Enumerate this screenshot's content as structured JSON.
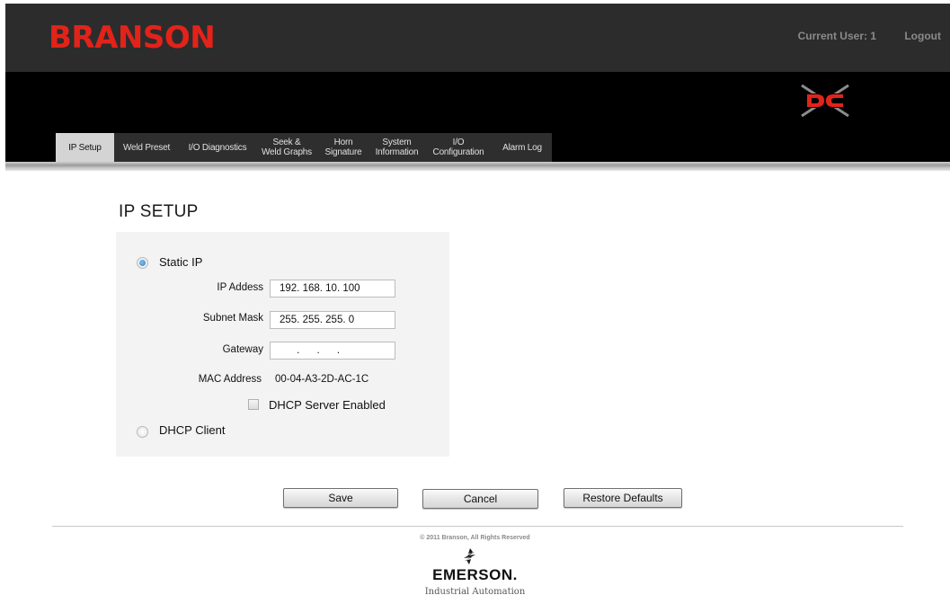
{
  "header": {
    "brand": "BRANSON",
    "current_user": "Current User: 1",
    "logout": "Logout"
  },
  "tabs": [
    {
      "line1": "IP Setup",
      "active": true
    },
    {
      "line1": "Weld Preset"
    },
    {
      "line1": "I/O Diagnostics"
    },
    {
      "line1": "Seek &",
      "line2": "Weld Graphs"
    },
    {
      "line1": "Horn",
      "line2": "Signature"
    },
    {
      "line1": "System",
      "line2": "Information"
    },
    {
      "line1": "I/O",
      "line2": "Configuration"
    },
    {
      "line1": "Alarm Log"
    }
  ],
  "page": {
    "title": "IP SETUP"
  },
  "ip_setup": {
    "static_ip_label": "Static IP",
    "static_ip_selected": true,
    "ip_address_label": "IP Addess",
    "ip_address_value": "192. 168. 10. 100",
    "subnet_mask_label": "Subnet Mask",
    "subnet_mask_value": "255. 255. 255. 0",
    "gateway_label": "Gateway",
    "gateway_value": "      .      .      .",
    "mac_address_label": "MAC Address",
    "mac_address_value": "00-04-A3-2D-AC-1C",
    "dhcp_server_label": "DHCP Server Enabled",
    "dhcp_server_checked": false,
    "dhcp_client_label": "DHCP Client",
    "dhcp_client_selected": false
  },
  "buttons": {
    "save": "Save",
    "cancel": "Cancel",
    "restore_defaults": "Restore Defaults"
  },
  "footer": {
    "copyright": "© 2011 Branson, All Rights Reserved",
    "company": "EMERSON.",
    "division": "Industrial Automation"
  },
  "colors": {
    "brand_red": "#e2231a",
    "header_dark": "#2c2c2c",
    "active_tab": "#d4d4d4",
    "radio_selected": "#2f80c4"
  }
}
